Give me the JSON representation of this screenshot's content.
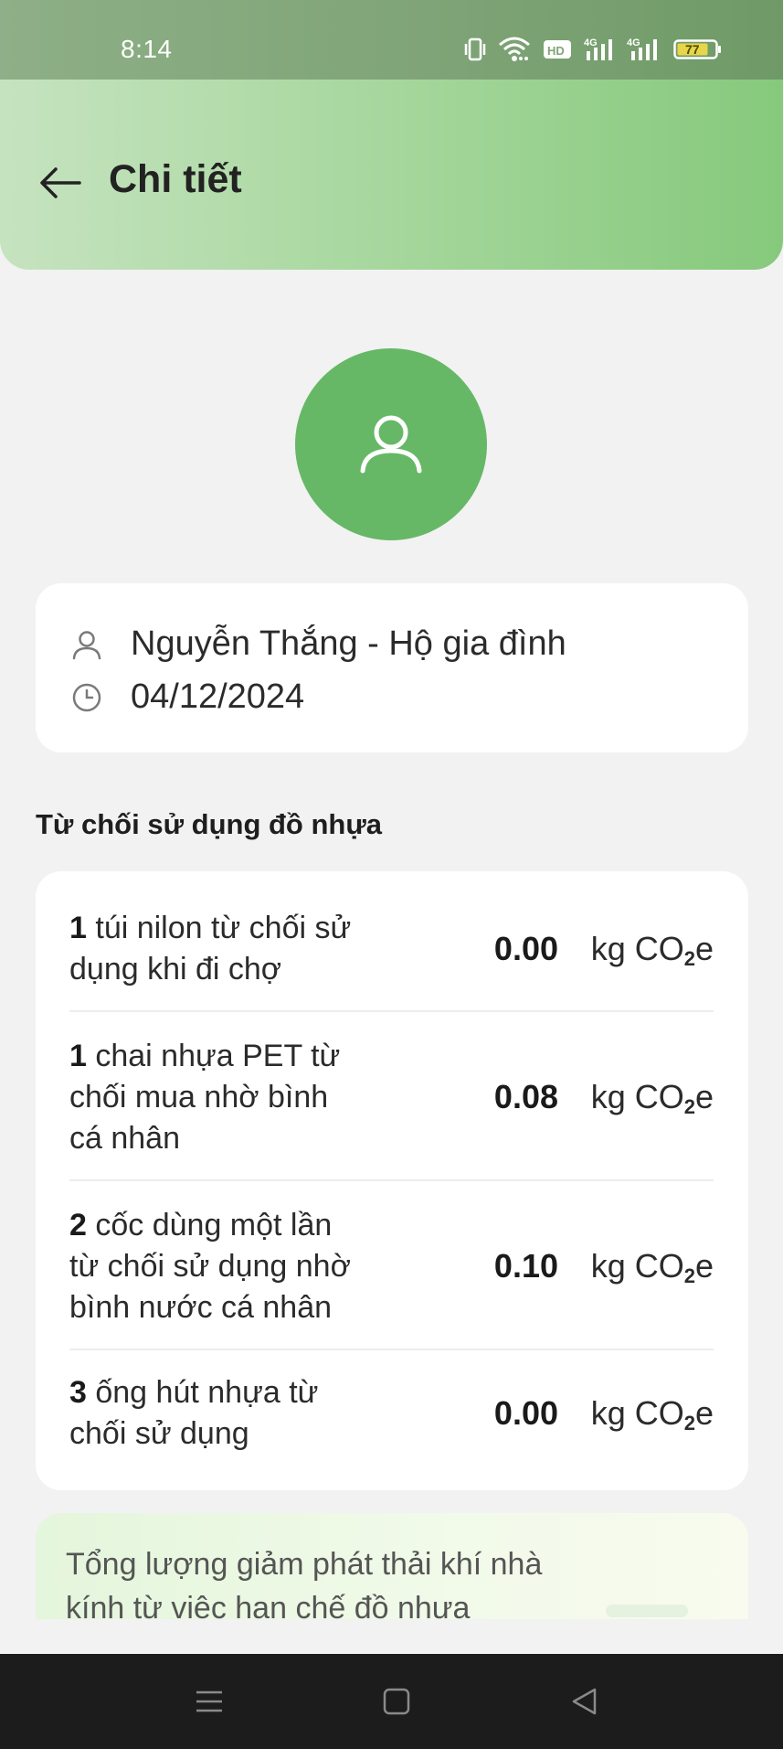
{
  "status_bar": {
    "time": "8:14",
    "battery": "77",
    "icons": [
      "vibrate-icon",
      "wifi-icon",
      "hd-icon",
      "signal-4g-icon",
      "signal-4g-icon",
      "battery-icon"
    ]
  },
  "header": {
    "title": "Chi tiết",
    "back_icon": "arrow-left-icon"
  },
  "profile": {
    "avatar_icon": "user-icon",
    "name": "Nguyễn Thắng - Hộ gia đình",
    "date": "04/12/2024"
  },
  "section": {
    "title": "Từ chối sử dụng đồ nhựa"
  },
  "items": [
    {
      "count": "1",
      "line1": " túi nilon từ chối sử",
      "line2": "dụng khi đi chợ",
      "line3": "",
      "value": "0.00",
      "unit": "kg CO",
      "unit_sub": "2",
      "unit_suffix": "e"
    },
    {
      "count": "1",
      "line1": " chai nhựa PET từ",
      "line2": "chối mua nhờ bình",
      "line3": "cá nhân",
      "value": "0.08",
      "unit": "kg CO",
      "unit_sub": "2",
      "unit_suffix": "e"
    },
    {
      "count": "2",
      "line1": " cốc dùng một lần",
      "line2": "từ chối sử dụng nhờ",
      "line3": "bình nước cá nhân",
      "value": "0.10",
      "unit": "kg CO",
      "unit_sub": "2",
      "unit_suffix": "e"
    },
    {
      "count": "3",
      "line1": " ống hút nhựa từ",
      "line2": "chối sử dụng",
      "line3": "",
      "value": "0.00",
      "unit": "kg CO",
      "unit_sub": "2",
      "unit_suffix": "e"
    }
  ],
  "summary": {
    "line1": "Tổng lượng giảm phát thải khí nhà",
    "line2": "kính từ việc hạn chế đồ nhựa"
  },
  "colors": {
    "accent": "#66b866",
    "header_gradient_start": "#c6e3c0",
    "header_gradient_end": "#86c97c",
    "background": "#f2f2f2",
    "navbar": "#1c1c1c"
  }
}
